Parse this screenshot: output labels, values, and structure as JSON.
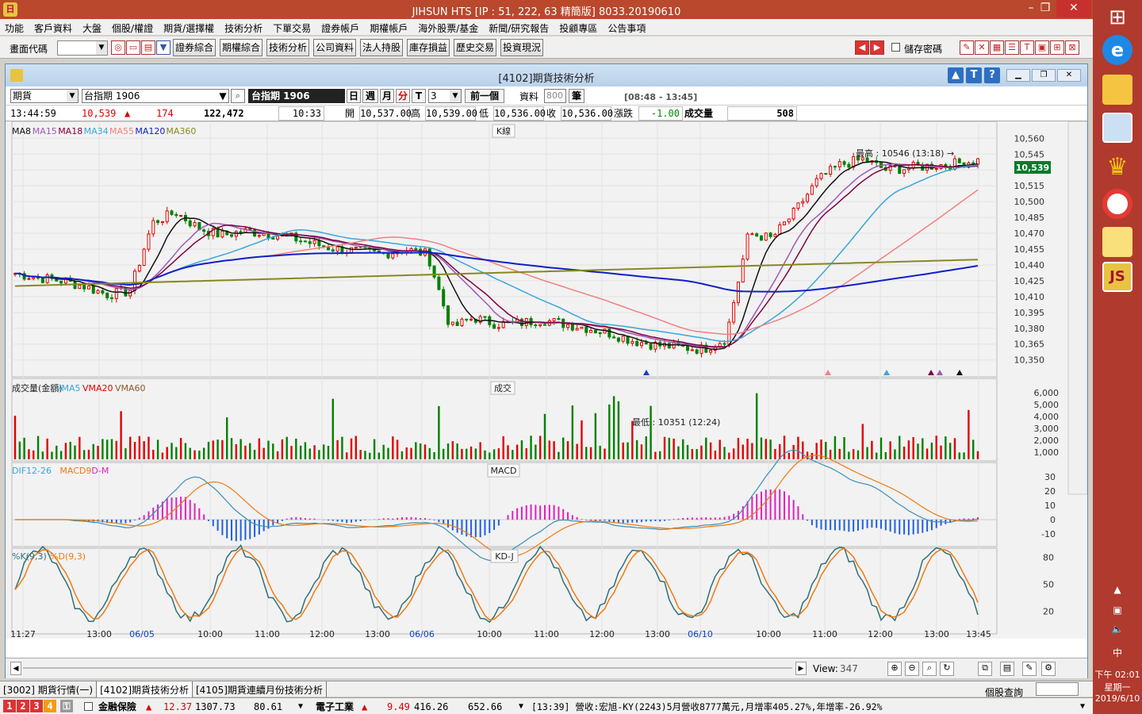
{
  "window": {
    "title": "JIHSUN HTS      [IP : 51, 222, 63 精簡版] 8033.20190610"
  },
  "menu": [
    "功能",
    "客戶資料",
    "大盤",
    "個股/權證",
    "期貨/選擇權",
    "技術分析",
    "下單交易",
    "證券帳戶",
    "期權帳戶",
    "海外股票/基金",
    "新聞/研究報告",
    "投顧專區",
    "公告事項"
  ],
  "toolbar": {
    "code_label": "畫面代碼",
    "buttons": [
      "證券綜合",
      "期權綜合",
      "技術分析",
      "公司資料",
      "法人持股",
      "庫存損益",
      "歷史交易",
      "投資現況"
    ],
    "save_password": "儲存密碼"
  },
  "inner": {
    "title": "[4102]期貨技術分析",
    "type_select": "期貨",
    "contract_select": "台指期 1906",
    "contract_name": "台指期 1906",
    "periods": [
      "日",
      "週",
      "月",
      "分",
      "T"
    ],
    "minute_value": "3",
    "prev_btn": "前一個",
    "data_label": "資料",
    "data_count": "800",
    "data_unit": "筆",
    "session": "[08:48 - 13:45]"
  },
  "quote": {
    "time": "13:44:59",
    "price": "10,539",
    "change": "174",
    "volume": "122,472",
    "bar_time": "10:33",
    "open_label": "開",
    "open": "10,537.00",
    "high_label": "高",
    "high": "10,539.00",
    "low_label": "低",
    "low": "10,536.00",
    "close_label": "收",
    "close": "10,536.00",
    "chg_label": "漲跌",
    "chg": "-1.00",
    "vol_label": "成交量",
    "vol": "508"
  },
  "chart_data": [
    {
      "type": "candlestick",
      "title": "K線",
      "legend": [
        "MA8",
        "MA15",
        "MA18",
        "MA34",
        "MA55",
        "MA120",
        "MA360"
      ],
      "y_ticks": [
        10560,
        10545,
        10530,
        10515,
        10500,
        10485,
        10470,
        10455,
        10440,
        10425,
        10410,
        10395,
        10380,
        10365,
        10350
      ],
      "ylim": [
        10340,
        10570
      ],
      "last_price": "10,539",
      "annotations": [
        "最高 : 10546 (13:18) →",
        "最低 : 10351 (12:24)"
      ],
      "x_labels": [
        "11:27",
        "13:00",
        "06/05",
        "10:00",
        "11:00",
        "12:00",
        "13:00",
        "06/06",
        "10:00",
        "11:00",
        "12:00",
        "13:00",
        "06/10",
        "10:00",
        "11:00",
        "12:00",
        "13:00",
        "13:45"
      ],
      "close_trend": [
        10432,
        10428,
        10425,
        10420,
        10412,
        10415,
        10480,
        10490,
        10475,
        10468,
        10472,
        10470,
        10466,
        10460,
        10455,
        10453,
        10450,
        10455,
        10450,
        10380,
        10390,
        10384,
        10385,
        10388,
        10384,
        10380,
        10375,
        10368,
        10364,
        10362,
        10360,
        10370,
        10470,
        10465,
        10490,
        10520,
        10535,
        10540,
        10530,
        10532,
        10534,
        10536,
        10539
      ]
    },
    {
      "type": "bar",
      "title": "成交",
      "legend": [
        "成交量(金額)",
        "VMA5",
        "VMA20",
        "VMA60"
      ],
      "y_ticks": [
        "6,000",
        "5,000",
        "4,000",
        "3,000",
        "2,000",
        "1,000"
      ]
    },
    {
      "type": "line",
      "title": "MACD",
      "legend": [
        "DIF12-26",
        "MACD9",
        "D-M"
      ],
      "y_ticks": [
        30,
        20,
        10,
        0,
        -10
      ]
    },
    {
      "type": "line",
      "title": "KD-J",
      "legend": [
        "%K(9,3)",
        "%D(9,3)"
      ],
      "y_ticks": [
        80,
        50,
        20
      ]
    }
  ],
  "bottom": {
    "view_label": "View:",
    "view_value": "347"
  },
  "tabs": [
    "[3002] 期貨行情(一)",
    "[4102]期貨技術分析",
    "[4105]期貨連續月份技術分析"
  ],
  "right_label": "個股查詢",
  "status": {
    "stock1": "金融保險",
    "s1_change": "12.37",
    "s1_index": "1307.73",
    "s1_val": "80.61",
    "stock2": "電子工業",
    "s2_change": "9.49",
    "s2_index": "416.26",
    "s2_val": "652.66",
    "news": "[13:39] 營收:宏旭-KY(2243)5月營收8777萬元,月增率405.27%,年增率-26.92%"
  },
  "taskbar": {
    "time": "下午 02:01",
    "day": "星期一",
    "date": "2019/6/10",
    "ime": "中"
  },
  "colors": {
    "ma8": "#111111",
    "ma15": "#9b59b6",
    "ma18": "#800040",
    "ma34": "#3aa6dc",
    "ma55": "#f08080",
    "ma120": "#1020c8",
    "ma360": "#888820",
    "up": "#e00000",
    "down": "#008000"
  }
}
